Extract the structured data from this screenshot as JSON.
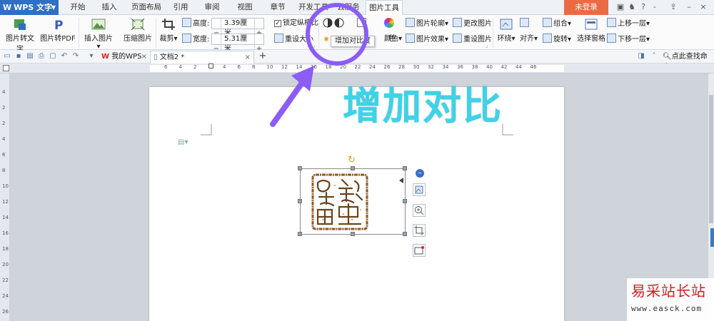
{
  "app": {
    "name": "WPS 文字",
    "logo": "W"
  },
  "menu_tabs": [
    {
      "label": "开始"
    },
    {
      "label": "插入"
    },
    {
      "label": "页面布局"
    },
    {
      "label": "引用"
    },
    {
      "label": "审阅"
    },
    {
      "label": "视图"
    },
    {
      "label": "章节"
    },
    {
      "label": "开发工具"
    },
    {
      "label": "云服务"
    },
    {
      "label": "图片工具",
      "active": true
    }
  ],
  "login_label": "未登录",
  "ribbon": {
    "pic_to_text": "图片转文字",
    "pic_to_pdf": "图片转PDF",
    "insert_pic": "插入图片",
    "compress_pic": "压缩图片",
    "crop": "裁剪",
    "height_label": "高度:",
    "height_value": "3.39厘米",
    "width_label": "宽度:",
    "width_value": "5.31厘米",
    "lock_ratio": "锁定纵横比",
    "reset_size": "重设大小",
    "color_button": "颜色",
    "recolor_partial": "色",
    "pic_outline": "图片轮廓",
    "pic_effect": "图片效果",
    "change_pic": "更改图片",
    "reset_pic": "重设图片",
    "wrap": "环绕",
    "align": "对齐",
    "rotate": "旋转",
    "group": "组合",
    "selection_pane": "选择窗格",
    "bring_forward": "上移一层",
    "send_backward": "下移一层"
  },
  "tooltip": "增加对比度",
  "doc_tabs": [
    {
      "label": "我的WPS"
    },
    {
      "label": "文档2 *",
      "active": true
    }
  ],
  "search_command": "点此查找命令",
  "ruler_ticks": [
    "6",
    "4",
    "2",
    "2",
    "4",
    "6",
    "8",
    "10",
    "12",
    "14",
    "16",
    "18",
    "20",
    "22",
    "24",
    "26",
    "28",
    "30",
    "32",
    "34",
    "36",
    "38",
    "40",
    "42",
    "44",
    "46"
  ],
  "vruler_ticks": [
    "4",
    "2",
    "2",
    "4",
    "6",
    "8",
    "10",
    "12",
    "14",
    "16",
    "18",
    "20",
    "22",
    "24",
    "26"
  ],
  "annotation": "增加对比",
  "watermark": {
    "title": "易采站长站",
    "url": "www.easck.com"
  },
  "colors": {
    "accent": "#2f6fc4",
    "login": "#ec6a43",
    "annotation": "#3fd2e8",
    "circle": "#8b5cf6",
    "arrow": "#8b5cf6"
  }
}
